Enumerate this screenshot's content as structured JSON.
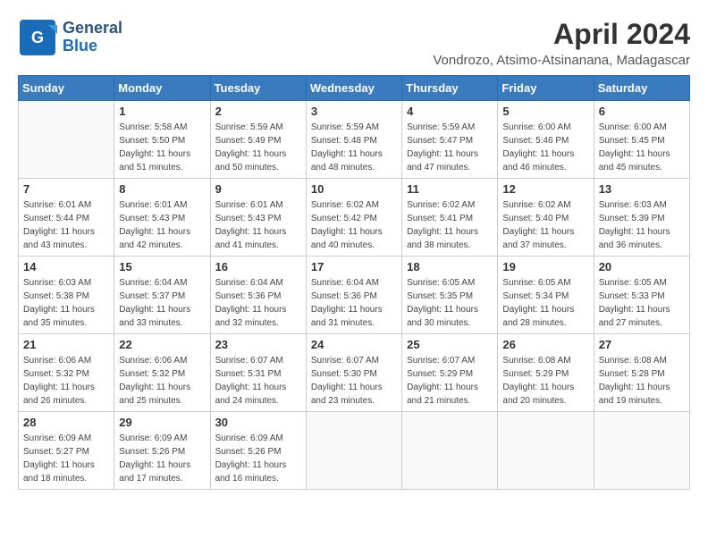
{
  "header": {
    "logo_general": "General",
    "logo_blue": "Blue",
    "month_year": "April 2024",
    "location": "Vondrozo, Atsimo-Atsinanana, Madagascar"
  },
  "weekdays": [
    "Sunday",
    "Monday",
    "Tuesday",
    "Wednesday",
    "Thursday",
    "Friday",
    "Saturday"
  ],
  "weeks": [
    [
      {
        "day": "",
        "sunrise": "",
        "sunset": "",
        "daylight": "",
        "minutes": ""
      },
      {
        "day": "1",
        "sunrise": "Sunrise: 5:58 AM",
        "sunset": "Sunset: 5:50 PM",
        "daylight": "Daylight: 11 hours",
        "minutes": "and 51 minutes."
      },
      {
        "day": "2",
        "sunrise": "Sunrise: 5:59 AM",
        "sunset": "Sunset: 5:49 PM",
        "daylight": "Daylight: 11 hours",
        "minutes": "and 50 minutes."
      },
      {
        "day": "3",
        "sunrise": "Sunrise: 5:59 AM",
        "sunset": "Sunset: 5:48 PM",
        "daylight": "Daylight: 11 hours",
        "minutes": "and 48 minutes."
      },
      {
        "day": "4",
        "sunrise": "Sunrise: 5:59 AM",
        "sunset": "Sunset: 5:47 PM",
        "daylight": "Daylight: 11 hours",
        "minutes": "and 47 minutes."
      },
      {
        "day": "5",
        "sunrise": "Sunrise: 6:00 AM",
        "sunset": "Sunset: 5:46 PM",
        "daylight": "Daylight: 11 hours",
        "minutes": "and 46 minutes."
      },
      {
        "day": "6",
        "sunrise": "Sunrise: 6:00 AM",
        "sunset": "Sunset: 5:45 PM",
        "daylight": "Daylight: 11 hours",
        "minutes": "and 45 minutes."
      }
    ],
    [
      {
        "day": "7",
        "sunrise": "Sunrise: 6:01 AM",
        "sunset": "Sunset: 5:44 PM",
        "daylight": "Daylight: 11 hours",
        "minutes": "and 43 minutes."
      },
      {
        "day": "8",
        "sunrise": "Sunrise: 6:01 AM",
        "sunset": "Sunset: 5:43 PM",
        "daylight": "Daylight: 11 hours",
        "minutes": "and 42 minutes."
      },
      {
        "day": "9",
        "sunrise": "Sunrise: 6:01 AM",
        "sunset": "Sunset: 5:43 PM",
        "daylight": "Daylight: 11 hours",
        "minutes": "and 41 minutes."
      },
      {
        "day": "10",
        "sunrise": "Sunrise: 6:02 AM",
        "sunset": "Sunset: 5:42 PM",
        "daylight": "Daylight: 11 hours",
        "minutes": "and 40 minutes."
      },
      {
        "day": "11",
        "sunrise": "Sunrise: 6:02 AM",
        "sunset": "Sunset: 5:41 PM",
        "daylight": "Daylight: 11 hours",
        "minutes": "and 38 minutes."
      },
      {
        "day": "12",
        "sunrise": "Sunrise: 6:02 AM",
        "sunset": "Sunset: 5:40 PM",
        "daylight": "Daylight: 11 hours",
        "minutes": "and 37 minutes."
      },
      {
        "day": "13",
        "sunrise": "Sunrise: 6:03 AM",
        "sunset": "Sunset: 5:39 PM",
        "daylight": "Daylight: 11 hours",
        "minutes": "and 36 minutes."
      }
    ],
    [
      {
        "day": "14",
        "sunrise": "Sunrise: 6:03 AM",
        "sunset": "Sunset: 5:38 PM",
        "daylight": "Daylight: 11 hours",
        "minutes": "and 35 minutes."
      },
      {
        "day": "15",
        "sunrise": "Sunrise: 6:04 AM",
        "sunset": "Sunset: 5:37 PM",
        "daylight": "Daylight: 11 hours",
        "minutes": "and 33 minutes."
      },
      {
        "day": "16",
        "sunrise": "Sunrise: 6:04 AM",
        "sunset": "Sunset: 5:36 PM",
        "daylight": "Daylight: 11 hours",
        "minutes": "and 32 minutes."
      },
      {
        "day": "17",
        "sunrise": "Sunrise: 6:04 AM",
        "sunset": "Sunset: 5:36 PM",
        "daylight": "Daylight: 11 hours",
        "minutes": "and 31 minutes."
      },
      {
        "day": "18",
        "sunrise": "Sunrise: 6:05 AM",
        "sunset": "Sunset: 5:35 PM",
        "daylight": "Daylight: 11 hours",
        "minutes": "and 30 minutes."
      },
      {
        "day": "19",
        "sunrise": "Sunrise: 6:05 AM",
        "sunset": "Sunset: 5:34 PM",
        "daylight": "Daylight: 11 hours",
        "minutes": "and 28 minutes."
      },
      {
        "day": "20",
        "sunrise": "Sunrise: 6:05 AM",
        "sunset": "Sunset: 5:33 PM",
        "daylight": "Daylight: 11 hours",
        "minutes": "and 27 minutes."
      }
    ],
    [
      {
        "day": "21",
        "sunrise": "Sunrise: 6:06 AM",
        "sunset": "Sunset: 5:32 PM",
        "daylight": "Daylight: 11 hours",
        "minutes": "and 26 minutes."
      },
      {
        "day": "22",
        "sunrise": "Sunrise: 6:06 AM",
        "sunset": "Sunset: 5:32 PM",
        "daylight": "Daylight: 11 hours",
        "minutes": "and 25 minutes."
      },
      {
        "day": "23",
        "sunrise": "Sunrise: 6:07 AM",
        "sunset": "Sunset: 5:31 PM",
        "daylight": "Daylight: 11 hours",
        "minutes": "and 24 minutes."
      },
      {
        "day": "24",
        "sunrise": "Sunrise: 6:07 AM",
        "sunset": "Sunset: 5:30 PM",
        "daylight": "Daylight: 11 hours",
        "minutes": "and 23 minutes."
      },
      {
        "day": "25",
        "sunrise": "Sunrise: 6:07 AM",
        "sunset": "Sunset: 5:29 PM",
        "daylight": "Daylight: 11 hours",
        "minutes": "and 21 minutes."
      },
      {
        "day": "26",
        "sunrise": "Sunrise: 6:08 AM",
        "sunset": "Sunset: 5:29 PM",
        "daylight": "Daylight: 11 hours",
        "minutes": "and 20 minutes."
      },
      {
        "day": "27",
        "sunrise": "Sunrise: 6:08 AM",
        "sunset": "Sunset: 5:28 PM",
        "daylight": "Daylight: 11 hours",
        "minutes": "and 19 minutes."
      }
    ],
    [
      {
        "day": "28",
        "sunrise": "Sunrise: 6:09 AM",
        "sunset": "Sunset: 5:27 PM",
        "daylight": "Daylight: 11 hours",
        "minutes": "and 18 minutes."
      },
      {
        "day": "29",
        "sunrise": "Sunrise: 6:09 AM",
        "sunset": "Sunset: 5:26 PM",
        "daylight": "Daylight: 11 hours",
        "minutes": "and 17 minutes."
      },
      {
        "day": "30",
        "sunrise": "Sunrise: 6:09 AM",
        "sunset": "Sunset: 5:26 PM",
        "daylight": "Daylight: 11 hours",
        "minutes": "and 16 minutes."
      },
      {
        "day": "",
        "sunrise": "",
        "sunset": "",
        "daylight": "",
        "minutes": ""
      },
      {
        "day": "",
        "sunrise": "",
        "sunset": "",
        "daylight": "",
        "minutes": ""
      },
      {
        "day": "",
        "sunrise": "",
        "sunset": "",
        "daylight": "",
        "minutes": ""
      },
      {
        "day": "",
        "sunrise": "",
        "sunset": "",
        "daylight": "",
        "minutes": ""
      }
    ]
  ]
}
